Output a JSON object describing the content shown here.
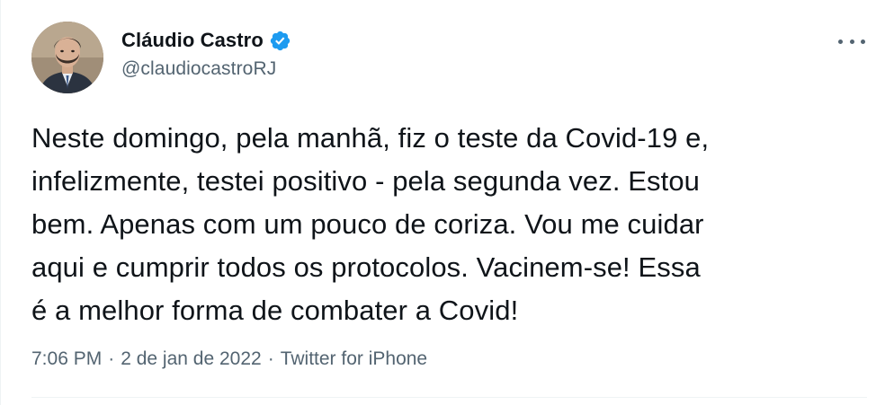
{
  "author": {
    "name": "Cláudio Castro",
    "handle": "@claudiocastroRJ",
    "verified": true
  },
  "tweet": {
    "text": "Neste domingo, pela manhã, fiz o teste da Covid-19 e,\ninfelizmente, testei positivo - pela segunda vez. Estou\nbem. Apenas com um pouco de coriza. Vou me cuidar\naqui e cumprir todos os protocolos. Vacinem-se! Essa\né a melhor forma de combater a Covid!",
    "time": "7:06 PM",
    "separator": "·",
    "date": "2 de jan de 2022",
    "source": "Twitter for iPhone"
  },
  "icons": {
    "verified": "verified-badge-icon",
    "more": "more-options-icon"
  },
  "colors": {
    "text_primary": "#0f1419",
    "text_secondary": "#536471",
    "verified_blue": "#1d9bf0",
    "divider": "#eff3f4"
  }
}
